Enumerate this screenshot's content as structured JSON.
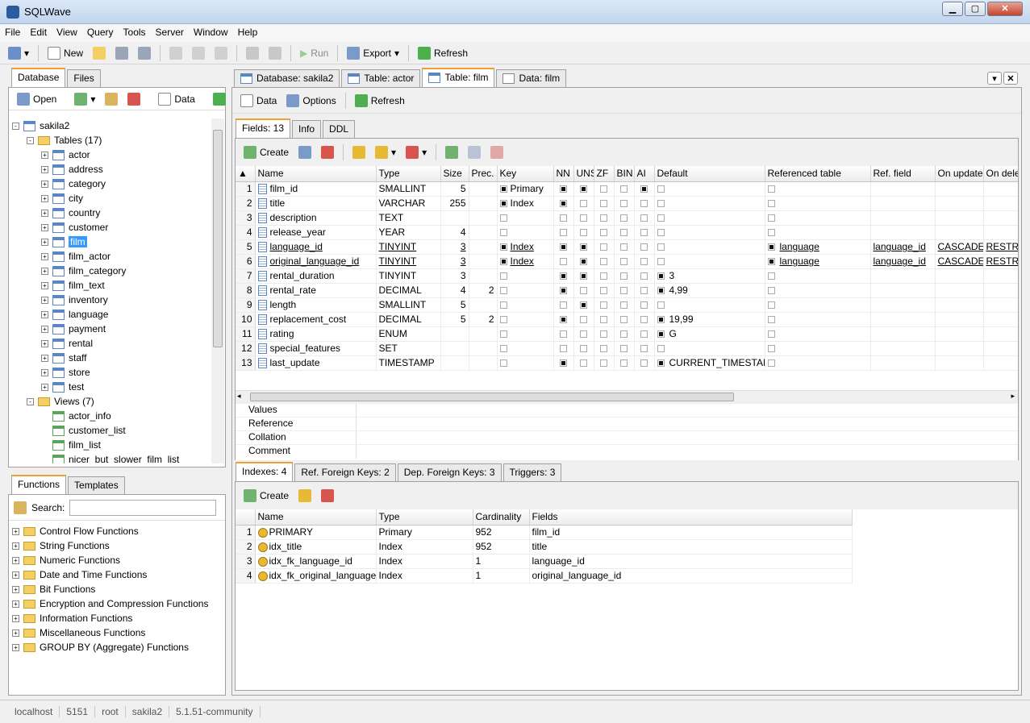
{
  "window": {
    "title": "SQLWave"
  },
  "menu": [
    "File",
    "Edit",
    "View",
    "Query",
    "Tools",
    "Server",
    "Window",
    "Help"
  ],
  "main_toolbar": {
    "new": "New",
    "run": "Run",
    "export": "Export",
    "refresh": "Refresh"
  },
  "left_tabs": [
    "Database",
    "Files"
  ],
  "db_toolbar": {
    "open": "Open",
    "data": "Data"
  },
  "tree": {
    "root": "sakila2",
    "tables_label": "Tables (17)",
    "tables": [
      "actor",
      "address",
      "category",
      "city",
      "country",
      "customer",
      "film",
      "film_actor",
      "film_category",
      "film_text",
      "inventory",
      "language",
      "payment",
      "rental",
      "staff",
      "store",
      "test"
    ],
    "selected": "film",
    "views_label": "Views (7)",
    "views": [
      "actor_info",
      "customer_list",
      "film_list",
      "nicer_but_slower_film_list"
    ]
  },
  "func_tabs": [
    "Functions",
    "Templates"
  ],
  "search_label": "Search:",
  "functions": [
    "Control Flow Functions",
    "String Functions",
    "Numeric Functions",
    "Date and Time Functions",
    "Bit Functions",
    "Encryption and Compression Functions",
    "Information Functions",
    "Miscellaneous Functions",
    "GROUP BY (Aggregate) Functions"
  ],
  "doc_tabs": [
    "Database: sakila2",
    "Table: actor",
    "Table: film",
    "Data: film"
  ],
  "doc_toolbar": {
    "data": "Data",
    "options": "Options",
    "refresh": "Refresh"
  },
  "sub_tabs": [
    "Fields: 13",
    "Info",
    "DDL"
  ],
  "fields_toolbar": {
    "create": "Create"
  },
  "fields_headers": [
    "Name",
    "Type",
    "Size",
    "Prec.",
    "Key",
    "NN",
    "UNS",
    "ZF",
    "BIN",
    "AI",
    "Default",
    "Referenced table",
    "Ref. field",
    "On update",
    "On delete"
  ],
  "fields": [
    {
      "n": "1",
      "name": "film_id",
      "type": "SMALLINT",
      "size": "5",
      "prec": "",
      "key": "Primary",
      "keyc": 1,
      "nn": 1,
      "uns": 1,
      "zf": 0,
      "bin": 0,
      "ai": 1,
      "defc": 0,
      "def": "",
      "refc": 0,
      "ref": "",
      "rf": "",
      "ou": "",
      "od": "",
      "link": 0
    },
    {
      "n": "2",
      "name": "title",
      "type": "VARCHAR",
      "size": "255",
      "prec": "",
      "key": "Index",
      "keyc": 1,
      "nn": 1,
      "uns": 0,
      "zf": 0,
      "bin": 0,
      "ai": 0,
      "defc": 0,
      "def": "",
      "refc": 0,
      "ref": "",
      "rf": "",
      "ou": "",
      "od": "",
      "link": 0
    },
    {
      "n": "3",
      "name": "description",
      "type": "TEXT",
      "size": "",
      "prec": "",
      "key": "",
      "keyc": 0,
      "nn": 0,
      "uns": 0,
      "zf": 0,
      "bin": 0,
      "ai": 0,
      "defc": 0,
      "def": "",
      "refc": 0,
      "ref": "",
      "rf": "",
      "ou": "",
      "od": "",
      "link": 0
    },
    {
      "n": "4",
      "name": "release_year",
      "type": "YEAR",
      "size": "4",
      "prec": "",
      "key": "",
      "keyc": 0,
      "nn": 0,
      "uns": 0,
      "zf": 0,
      "bin": 0,
      "ai": 0,
      "defc": 0,
      "def": "",
      "refc": 0,
      "ref": "",
      "rf": "",
      "ou": "",
      "od": "",
      "link": 0
    },
    {
      "n": "5",
      "name": "language_id",
      "type": "TINYINT",
      "size": "3",
      "prec": "",
      "key": "Index",
      "keyc": 1,
      "nn": 1,
      "uns": 1,
      "zf": 0,
      "bin": 0,
      "ai": 0,
      "defc": 0,
      "def": "",
      "refc": 1,
      "ref": "language",
      "rf": "language_id",
      "ou": "CASCADE",
      "od": "RESTRICT",
      "link": 1
    },
    {
      "n": "6",
      "name": "original_language_id",
      "type": "TINYINT",
      "size": "3",
      "prec": "",
      "key": "Index",
      "keyc": 1,
      "nn": 0,
      "uns": 1,
      "zf": 0,
      "bin": 0,
      "ai": 0,
      "defc": 0,
      "def": "",
      "refc": 1,
      "ref": "language",
      "rf": "language_id",
      "ou": "CASCADE",
      "od": "RESTRICT",
      "link": 1
    },
    {
      "n": "7",
      "name": "rental_duration",
      "type": "TINYINT",
      "size": "3",
      "prec": "",
      "key": "",
      "keyc": 0,
      "nn": 1,
      "uns": 1,
      "zf": 0,
      "bin": 0,
      "ai": 0,
      "defc": 1,
      "def": "3",
      "refc": 0,
      "ref": "",
      "rf": "",
      "ou": "",
      "od": "",
      "link": 0
    },
    {
      "n": "8",
      "name": "rental_rate",
      "type": "DECIMAL",
      "size": "4",
      "prec": "2",
      "key": "",
      "keyc": 0,
      "nn": 1,
      "uns": 0,
      "zf": 0,
      "bin": 0,
      "ai": 0,
      "defc": 1,
      "def": "4,99",
      "refc": 0,
      "ref": "",
      "rf": "",
      "ou": "",
      "od": "",
      "link": 0
    },
    {
      "n": "9",
      "name": "length",
      "type": "SMALLINT",
      "size": "5",
      "prec": "",
      "key": "",
      "keyc": 0,
      "nn": 0,
      "uns": 1,
      "zf": 0,
      "bin": 0,
      "ai": 0,
      "defc": 0,
      "def": "",
      "refc": 0,
      "ref": "",
      "rf": "",
      "ou": "",
      "od": "",
      "link": 0
    },
    {
      "n": "10",
      "name": "replacement_cost",
      "type": "DECIMAL",
      "size": "5",
      "prec": "2",
      "key": "",
      "keyc": 0,
      "nn": 1,
      "uns": 0,
      "zf": 0,
      "bin": 0,
      "ai": 0,
      "defc": 1,
      "def": "19,99",
      "refc": 0,
      "ref": "",
      "rf": "",
      "ou": "",
      "od": "",
      "link": 0
    },
    {
      "n": "11",
      "name": "rating",
      "type": "ENUM",
      "size": "",
      "prec": "",
      "key": "",
      "keyc": 0,
      "nn": 0,
      "uns": 0,
      "zf": 0,
      "bin": 0,
      "ai": 0,
      "defc": 1,
      "def": "G",
      "refc": 0,
      "ref": "",
      "rf": "",
      "ou": "",
      "od": "",
      "link": 0
    },
    {
      "n": "12",
      "name": "special_features",
      "type": "SET",
      "size": "",
      "prec": "",
      "key": "",
      "keyc": 0,
      "nn": 0,
      "uns": 0,
      "zf": 0,
      "bin": 0,
      "ai": 0,
      "defc": 0,
      "def": "",
      "refc": 0,
      "ref": "",
      "rf": "",
      "ou": "",
      "od": "",
      "link": 0
    },
    {
      "n": "13",
      "name": "last_update",
      "type": "TIMESTAMP",
      "size": "",
      "prec": "",
      "key": "",
      "keyc": 0,
      "nn": 1,
      "uns": 0,
      "zf": 0,
      "bin": 0,
      "ai": 0,
      "defc": 1,
      "def": "CURRENT_TIMESTAMP",
      "refc": 0,
      "ref": "",
      "rf": "",
      "ou": "",
      "od": "",
      "link": 0
    }
  ],
  "props": [
    "Values",
    "Reference",
    "Collation",
    "Comment"
  ],
  "bottom_tabs": [
    "Indexes: 4",
    "Ref. Foreign Keys: 2",
    "Dep. Foreign Keys: 3",
    "Triggers: 3"
  ],
  "index_toolbar": {
    "create": "Create"
  },
  "index_headers": [
    "Name",
    "Type",
    "Cardinality",
    "Fields"
  ],
  "indexes": [
    {
      "n": "1",
      "name": "PRIMARY",
      "type": "Primary",
      "card": "952",
      "fields": "film_id"
    },
    {
      "n": "2",
      "name": "idx_title",
      "type": "Index",
      "card": "952",
      "fields": "title"
    },
    {
      "n": "3",
      "name": "idx_fk_language_id",
      "type": "Index",
      "card": "1",
      "fields": "language_id"
    },
    {
      "n": "4",
      "name": "idx_fk_original_language_",
      "type": "Index",
      "card": "1",
      "fields": "original_language_id"
    }
  ],
  "status": [
    "localhost",
    "5151",
    "root",
    "sakila2",
    "5.1.51-community"
  ]
}
